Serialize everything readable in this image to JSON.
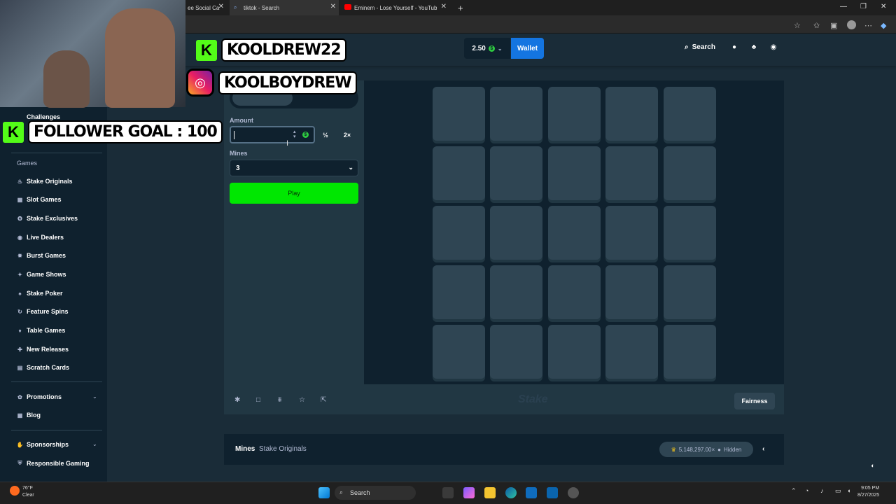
{
  "browser": {
    "tabs": [
      {
        "label": "ee Social Ca",
        "active": false
      },
      {
        "label": "tiktok - Search",
        "active": true
      },
      {
        "label": "Eminem - Lose Yourself - YouTube",
        "active": false
      }
    ],
    "new_tab": "+"
  },
  "header": {
    "balance": "2.50",
    "wallet": "Wallet",
    "search": "Search"
  },
  "sidebar": {
    "top_items": [
      "Challenges"
    ],
    "games_heading": "Games",
    "items": [
      "Stake Originals",
      "Slot Games",
      "Stake Exclusives",
      "Live Dealers",
      "Burst Games",
      "Game Shows",
      "Stake Poker",
      "Feature Spins",
      "Table Games",
      "New Releases",
      "Scratch Cards"
    ],
    "promotions": "Promotions",
    "blog": "Blog",
    "sponsorships": "Sponsorships",
    "responsible": "Responsible Gaming"
  },
  "game": {
    "amount_label": "Amount",
    "amount_value": "",
    "half": "½",
    "double": "2×",
    "mines_label": "Mines",
    "mines_value": "3",
    "play": "Play",
    "watermark": "Stake"
  },
  "footer": {
    "fairness": "Fairness",
    "game_name": "Mines",
    "category": "Stake Originals",
    "max_win": "5,148,297.00×",
    "hidden": "Hidden"
  },
  "overlay": {
    "kick_name": "KOOLDREW22",
    "ig_name": "KOOLBOYDREW",
    "goal": "FOLLOWER GOAL : 100"
  },
  "taskbar": {
    "weather_temp": "76°F",
    "weather_desc": "Clear",
    "search": "Search",
    "time": "9:05 PM",
    "date": "8/27/2025"
  },
  "colors": {
    "bg": "#1a2c38",
    "panel": "#213743",
    "tile": "#2f4553",
    "play": "#00e701",
    "wallet": "#1475e1"
  }
}
